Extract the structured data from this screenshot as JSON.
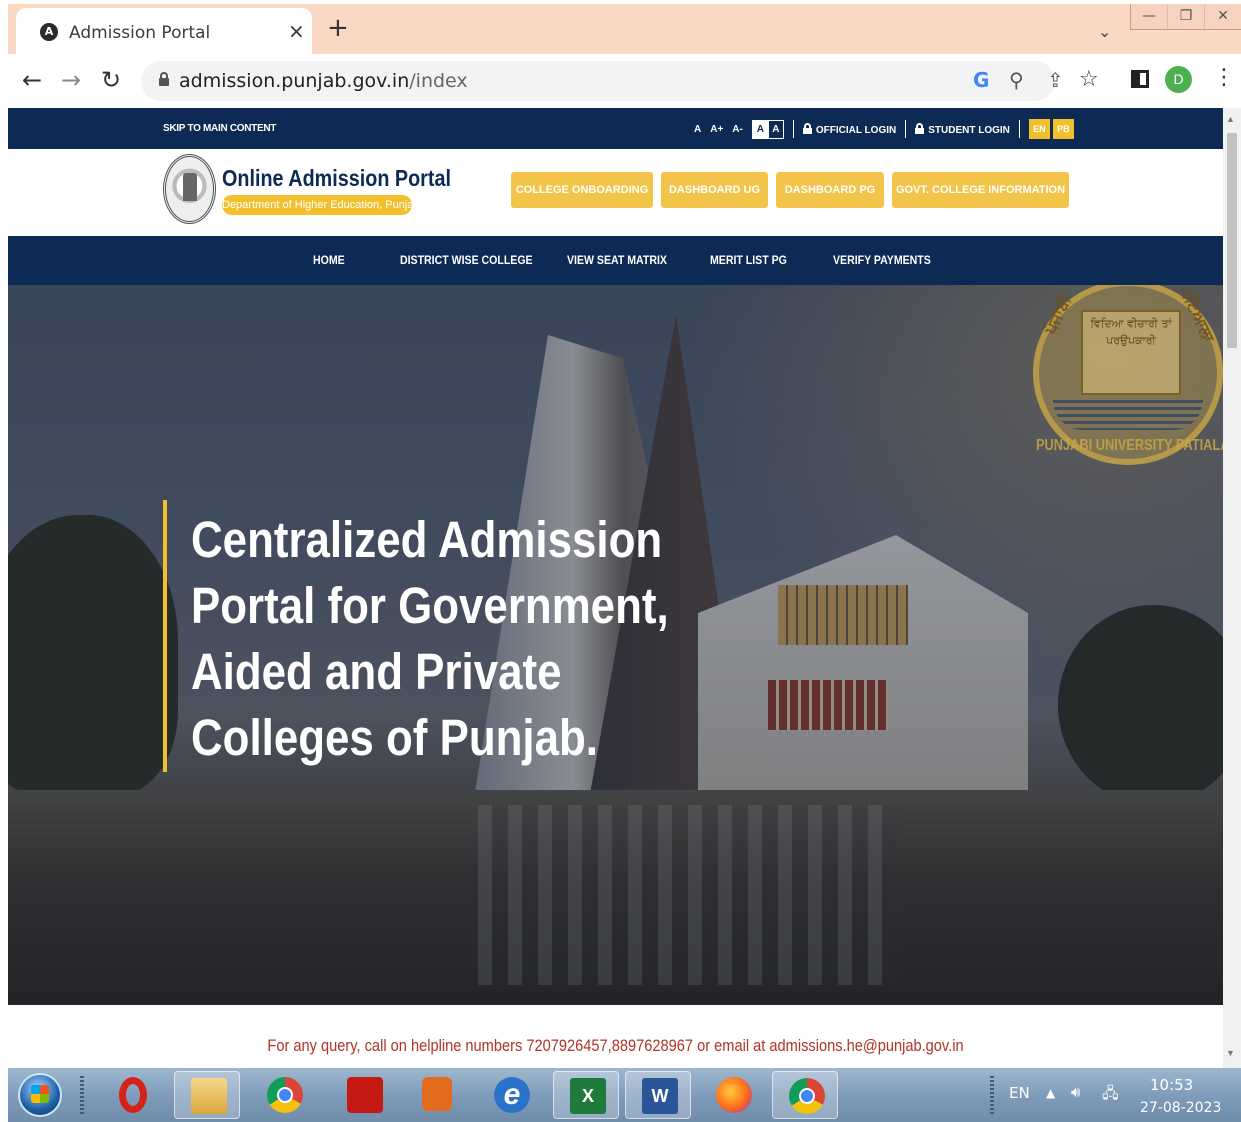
{
  "browser": {
    "tab_title": "Admission Portal",
    "tab_favicon_letter": "A",
    "tab_close": "×",
    "new_tab": "+",
    "tab_search": "⌄",
    "window_controls": {
      "minimize": "—",
      "restore": "❐",
      "close": "✕"
    },
    "url_host": "admission.punjab.gov.in",
    "url_path": "/index",
    "profile_initial": "D"
  },
  "utility_bar": {
    "skip_link": "SKIP TO MAIN CONTENT",
    "font_normal": "A",
    "font_increase": "A+",
    "font_decrease": "A-",
    "contrast_light": "A",
    "contrast_dark": "A",
    "official_login": "OFFICIAL LOGIN",
    "student_login": "STUDENT LOGIN",
    "lang_en": "EN",
    "lang_pb": "PB"
  },
  "header": {
    "portal_title": "Online Admission Portal",
    "department": "Department of Higher Education, Punjab",
    "buttons": [
      "COLLEGE ONBOARDING",
      "DASHBOARD UG",
      "DASHBOARD PG",
      "GOVT. COLLEGE INFORMATION"
    ]
  },
  "nav": {
    "items": [
      "HOME",
      "DISTRICT WISE COLLEGE",
      "VIEW SEAT MATRIX",
      "MERIT LIST PG",
      "VERIFY PAYMENTS"
    ]
  },
  "hero": {
    "headline": "Centralized Admission Portal for Government, Aided and Private Colleges of Punjab.",
    "seal_left": "ਪੰਜਾਬੀ",
    "seal_right": "ਪਟਿਆਲਾ",
    "seal_book": "ਵਿਦਿਆ ਵੀਚਾਰੀ ਤਾਂ ਪਰਉਪਕਾਰੀ",
    "seal_caption": "PUNJABI UNIVERSITY PATIALA"
  },
  "helpline": "For any query, call on helpline numbers 7207926457,8897628967  or email at admissions.he@punjab.gov.in",
  "taskbar": {
    "language": "EN",
    "time": "10:53",
    "date": "27-08-2023",
    "excel_glyph": "X",
    "word_glyph": "W",
    "ie_glyph": "e"
  },
  "colors": {
    "navy": "#0c2a54",
    "gold": "#f2c02f",
    "helpline_red": "#b0342a"
  }
}
